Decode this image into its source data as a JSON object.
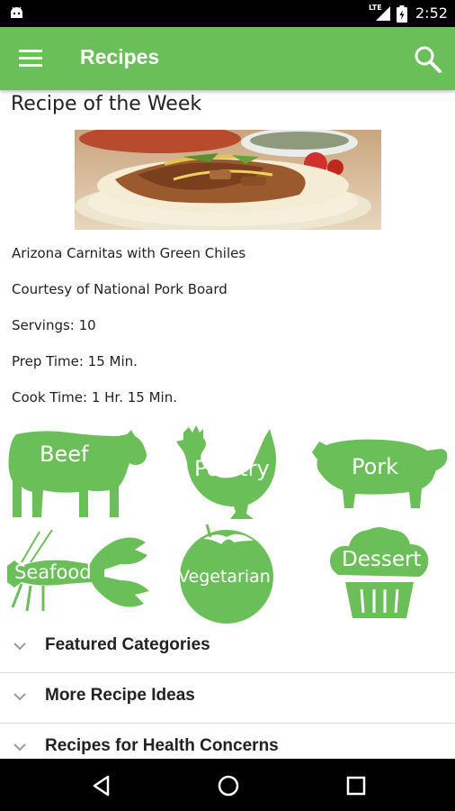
{
  "status_bar": {
    "time": "2:52",
    "network": "LTE"
  },
  "app_bar": {
    "title": "Recipes"
  },
  "recipe_of_week": {
    "heading": "Recipe of the Week",
    "name": "Arizona Carnitas with Green Chiles",
    "courtesy": "Courtesy of National Pork Board",
    "servings": "Servings: 10",
    "prep_time": "Prep Time: 15 Min.",
    "cook_time": "Cook Time: 1 Hr. 15 Min."
  },
  "categories": [
    {
      "label": "Beef",
      "icon": "cow-icon"
    },
    {
      "label": "Poultry",
      "icon": "chicken-icon"
    },
    {
      "label": "Pork",
      "icon": "pig-icon"
    },
    {
      "label": "Seafood",
      "icon": "lobster-icon"
    },
    {
      "label": "Vegetarian",
      "icon": "tomato-icon"
    },
    {
      "label": "Dessert",
      "icon": "cupcake-icon"
    }
  ],
  "accordions": [
    {
      "label": "Featured Categories"
    },
    {
      "label": "More Recipe Ideas"
    },
    {
      "label": "Recipes for Health Concerns"
    }
  ],
  "colors": {
    "accent": "#6bbf59",
    "status_bar": "#000000",
    "nav_bar": "#000000"
  }
}
